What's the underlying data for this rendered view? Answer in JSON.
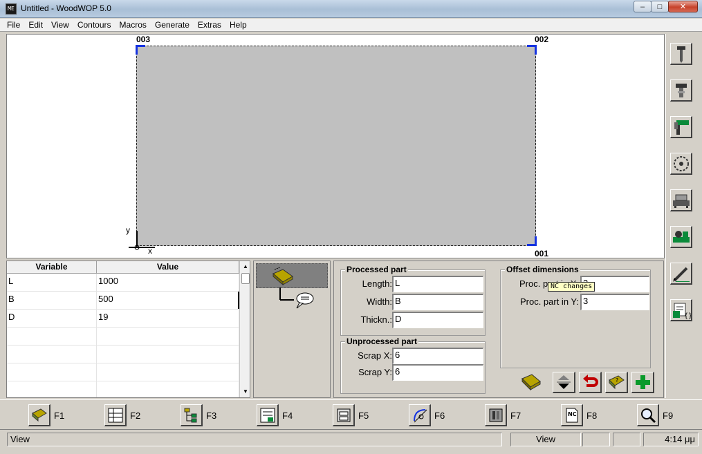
{
  "window": {
    "title": "Untitled - WoodWOP 5.0",
    "app_icon_text": "ME",
    "controls": {
      "minimize": "–",
      "maximize": "□",
      "close": "✕"
    }
  },
  "menu": [
    "File",
    "Edit",
    "View",
    "Contours",
    "Macros",
    "Generate",
    "Extras",
    "Help"
  ],
  "canvas": {
    "corner_labels": {
      "top_left": "003",
      "top_right": "002",
      "bottom_right": "001"
    },
    "axis_labels": {
      "y": "y",
      "x": "x"
    },
    "workpiece_color": "#c0c0c0",
    "corner_marker_color": "#1533e0"
  },
  "right_toolbar": [
    {
      "icon": "drill-vertical-icon"
    },
    {
      "icon": "drill-horizontal-icon"
    },
    {
      "icon": "routing-icon"
    },
    {
      "icon": "saw-blade-icon"
    },
    {
      "icon": "machine-table-icon"
    },
    {
      "icon": "edge-banding-icon"
    },
    {
      "icon": "pen-draw-icon"
    },
    {
      "icon": "nc-program-icon"
    }
  ],
  "variables": {
    "columns": [
      "Variable",
      "Value"
    ],
    "rows": [
      {
        "name": "L",
        "value": "1000"
      },
      {
        "name": "B",
        "value": "500"
      },
      {
        "name": "D",
        "value": "19"
      },
      {
        "name": "",
        "value": ""
      },
      {
        "name": "",
        "value": ""
      },
      {
        "name": "",
        "value": ""
      },
      {
        "name": "",
        "value": ""
      }
    ]
  },
  "tree": {
    "nodes": [
      {
        "icon": "workpiece-icon",
        "selected": true
      },
      {
        "icon": "comment-icon",
        "selected": false
      }
    ]
  },
  "processed_part": {
    "title": "Processed part",
    "fields": [
      {
        "label": "Length:",
        "value": "L"
      },
      {
        "label": "Width:",
        "value": "B"
      },
      {
        "label": "Thickn.:",
        "value": "D"
      }
    ]
  },
  "unprocessed_part": {
    "title": "Unprocessed part",
    "fields": [
      {
        "label": "Scrap X:",
        "value": "6"
      },
      {
        "label": "Scrap Y:",
        "value": "6"
      }
    ]
  },
  "offset_dimensions": {
    "title": "Offset dimensions",
    "fields": [
      {
        "label": "Proc. part in X:",
        "value": "3"
      },
      {
        "label": "Proc. part in Y:",
        "value": "3"
      }
    ]
  },
  "tooltip": "NC changes",
  "action_buttons": [
    "move-up-down-icon",
    "undo-icon",
    "help-book-icon",
    "add-icon"
  ],
  "function_keys": [
    {
      "label": "F1",
      "icon": "help-book-icon"
    },
    {
      "label": "F2",
      "icon": "variables-table-icon"
    },
    {
      "label": "F3",
      "icon": "tree-view-icon"
    },
    {
      "label": "F4",
      "icon": "list-icon"
    },
    {
      "label": "F5",
      "icon": "workpiece-properties-icon"
    },
    {
      "label": "F6",
      "icon": "contour-icon"
    },
    {
      "label": "F7",
      "icon": "machine-icon"
    },
    {
      "label": "F8",
      "icon": "nc-file-icon"
    },
    {
      "label": "F9",
      "icon": "zoom-icon"
    }
  ],
  "status": {
    "left": "View",
    "mode": "View",
    "time": "4:14 μμ"
  }
}
